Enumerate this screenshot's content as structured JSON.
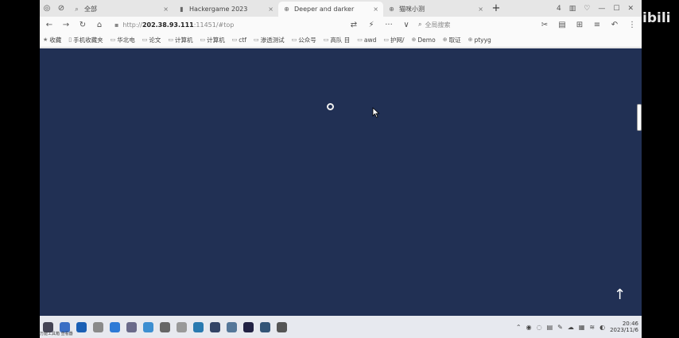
{
  "tabs": [
    {
      "label": "全部",
      "icon": "search-icon",
      "active": false
    },
    {
      "label": "Hackergame 2023",
      "icon": "site-icon",
      "active": false
    },
    {
      "label": "Deeper and darker",
      "icon": "globe-icon",
      "active": true
    },
    {
      "label": "猫咪小测",
      "icon": "globe-icon",
      "active": false
    }
  ],
  "tab_close": "×",
  "new_tab": "+",
  "tabbar_right": [
    "4",
    "▥",
    "♡",
    "—",
    "☐",
    "✕"
  ],
  "toolbar": {
    "back": "←",
    "forward": "→",
    "reload": "↻",
    "home": "⌂",
    "url_scheme": "http://",
    "url_host": "202.38.93.111",
    "url_rest": ":11451/#top",
    "search_placeholder": "全局搜索",
    "translate": "⇄",
    "bolt": "⚡",
    "more": "···",
    "dropdown": "∨",
    "right_icons": [
      "✂",
      "▤",
      "⊞",
      "≡",
      "↶",
      "⋮"
    ]
  },
  "bookmarks": [
    {
      "label": "收藏"
    },
    {
      "label": "手机收藏夹"
    },
    {
      "label": "华北电"
    },
    {
      "label": "论文"
    },
    {
      "label": "计算机"
    },
    {
      "label": "计算机"
    },
    {
      "label": "ctf"
    },
    {
      "label": "渗透测试"
    },
    {
      "label": "公众号"
    },
    {
      "label": "高队 目"
    },
    {
      "label": "awd"
    },
    {
      "label": "护网/"
    },
    {
      "label": "Demo"
    },
    {
      "label": "取证"
    },
    {
      "label": "ptyyg"
    }
  ],
  "page": {
    "background": "#213054",
    "back_to_top": "↑"
  },
  "taskbar": {
    "note": "万能工具箱 查看器",
    "apps": [
      {
        "name": "qr-app-icon",
        "color": "#445"
      },
      {
        "name": "app2-icon",
        "color": "#3a6ec4"
      },
      {
        "name": "app3-icon",
        "color": "#1a5fb4"
      },
      {
        "name": "app4-icon",
        "color": "#8a8a8a"
      },
      {
        "name": "app5-icon",
        "color": "#2d7ad6"
      },
      {
        "name": "app6-icon",
        "color": "#6a6a8a"
      },
      {
        "name": "app7-icon",
        "color": "#3d8fd1"
      },
      {
        "name": "app8-icon",
        "color": "#666666"
      },
      {
        "name": "app9-icon",
        "color": "#999999"
      },
      {
        "name": "app10-icon",
        "color": "#2a7ab0"
      },
      {
        "name": "app11-icon",
        "color": "#334466"
      },
      {
        "name": "app12-icon",
        "color": "#557799"
      },
      {
        "name": "app13-icon",
        "color": "#222244"
      },
      {
        "name": "app14-icon",
        "color": "#335577"
      },
      {
        "name": "app15-icon",
        "color": "#555555"
      }
    ],
    "tray_icons": [
      "⌃",
      "◉",
      "◌",
      "▤",
      "✎",
      "☁",
      "▦",
      "≋",
      "◐"
    ],
    "time": "20:46",
    "date": "2023/11/6"
  },
  "watermark": "ibili"
}
